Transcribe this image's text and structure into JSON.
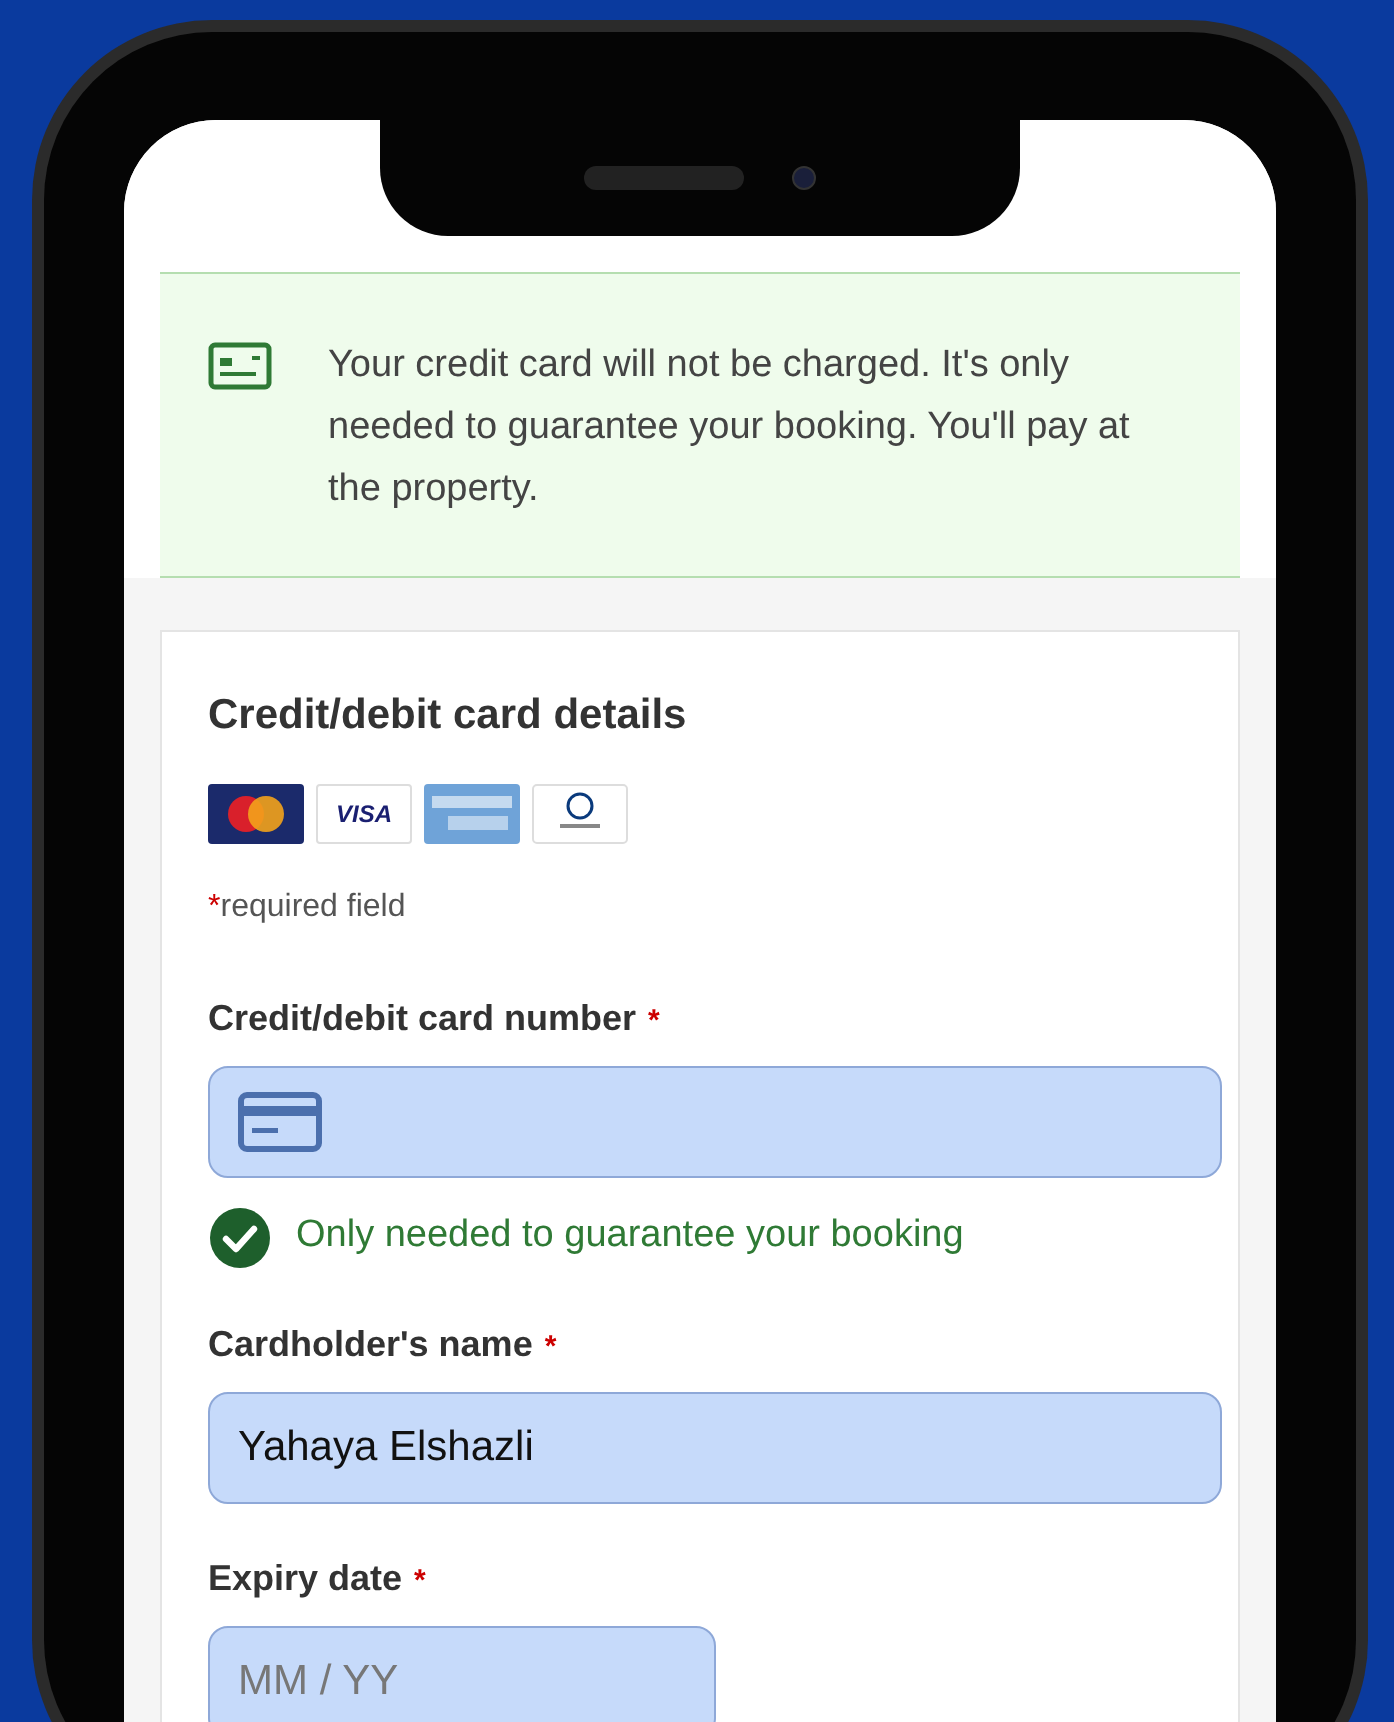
{
  "banner": {
    "text": "Your credit card will not be charged. It's only needed to guarantee your booking. You'll pay at the property."
  },
  "section": {
    "title": "Credit/debit card details",
    "card_logos": [
      {
        "kind": "mastercard"
      },
      {
        "kind": "visa",
        "text": "VISA"
      },
      {
        "kind": "amex"
      },
      {
        "kind": "diners"
      }
    ],
    "required_note": {
      "mark": "*",
      "text": "required field"
    },
    "fields": [
      {
        "kind": "card_number",
        "label": "Credit/debit card number",
        "required_mark": "*",
        "hint": "Only needed to guarantee your booking"
      },
      {
        "kind": "text",
        "label": "Cardholder's name",
        "required_mark": "*",
        "value": "Yahaya Elshazli"
      },
      {
        "kind": "short",
        "label": "Expiry date",
        "required_mark": "*",
        "placeholder": "MM / YY"
      }
    ]
  }
}
